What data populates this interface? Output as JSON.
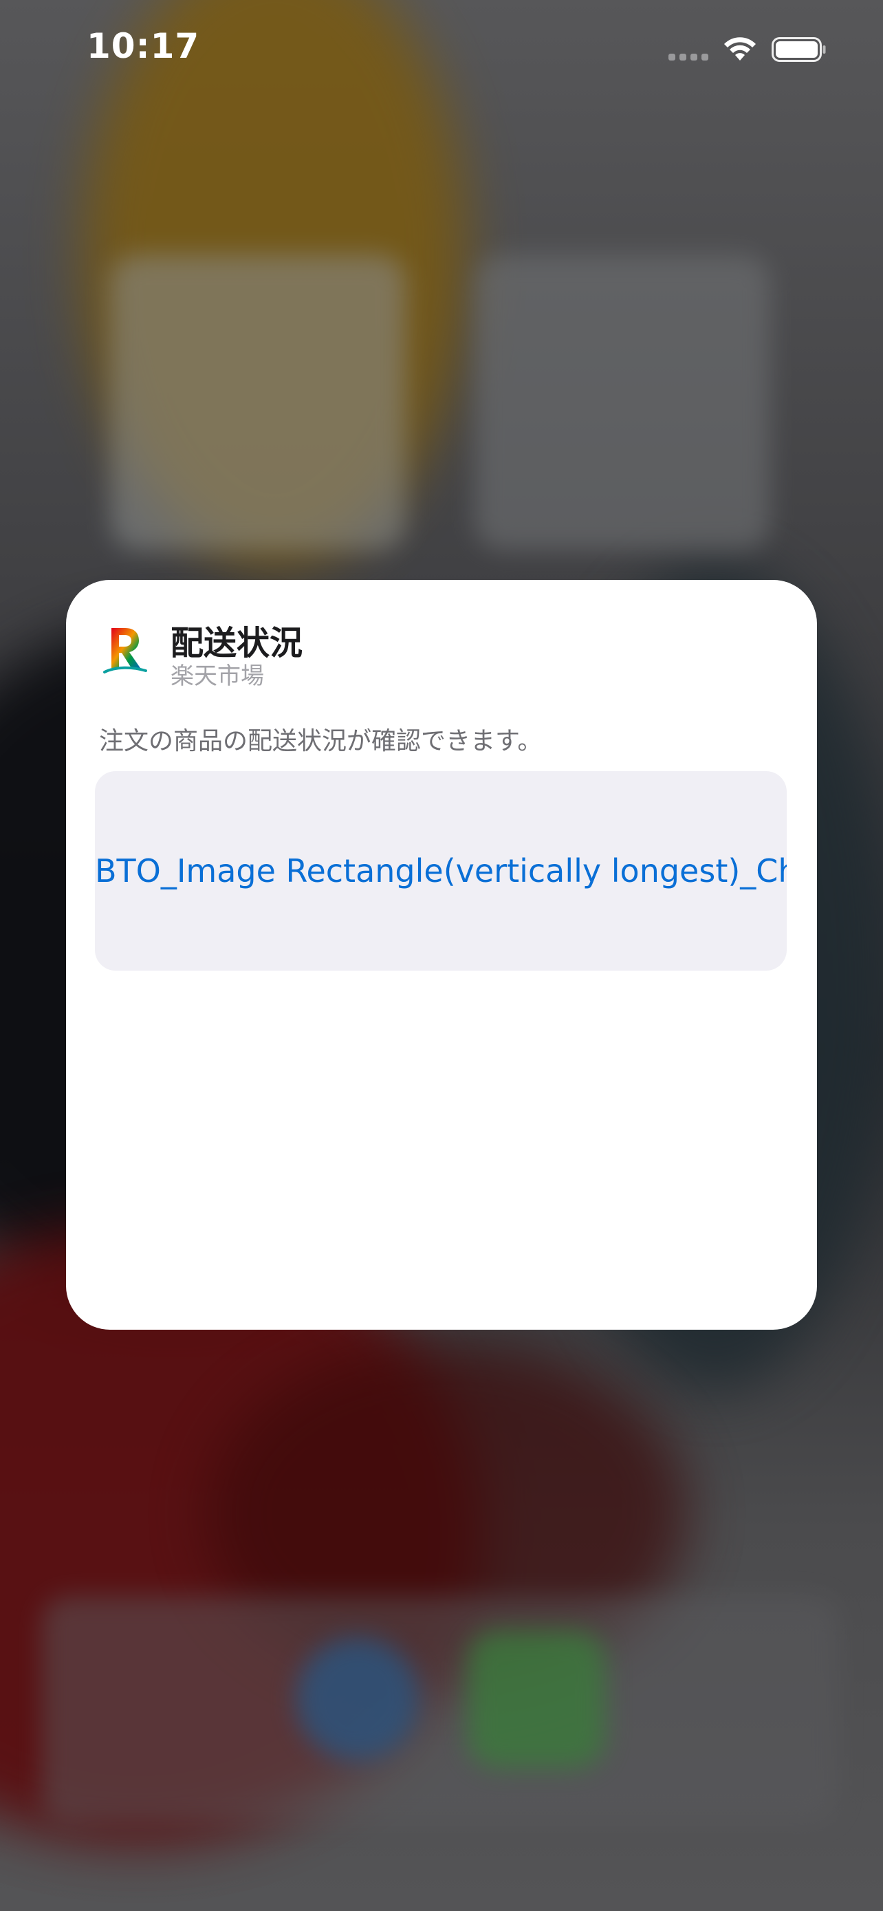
{
  "status_bar": {
    "time": "10:17",
    "icons": [
      "cellular-signal-icon",
      "wifi-icon",
      "battery-icon"
    ]
  },
  "widget": {
    "title": "配送状況",
    "app_name": "楽天市場",
    "description": "注文の商品の配送状況が確認できます。",
    "preview_placeholder": "BTO_Image Rectangle(vertically longest)_Ch",
    "colors": {
      "card_background": "#ffffff",
      "preview_background": "#f0eff5",
      "link_blue": "#0a6fd6",
      "title_text": "#1c1c1e",
      "secondary_text": "#a3a3a8"
    }
  }
}
